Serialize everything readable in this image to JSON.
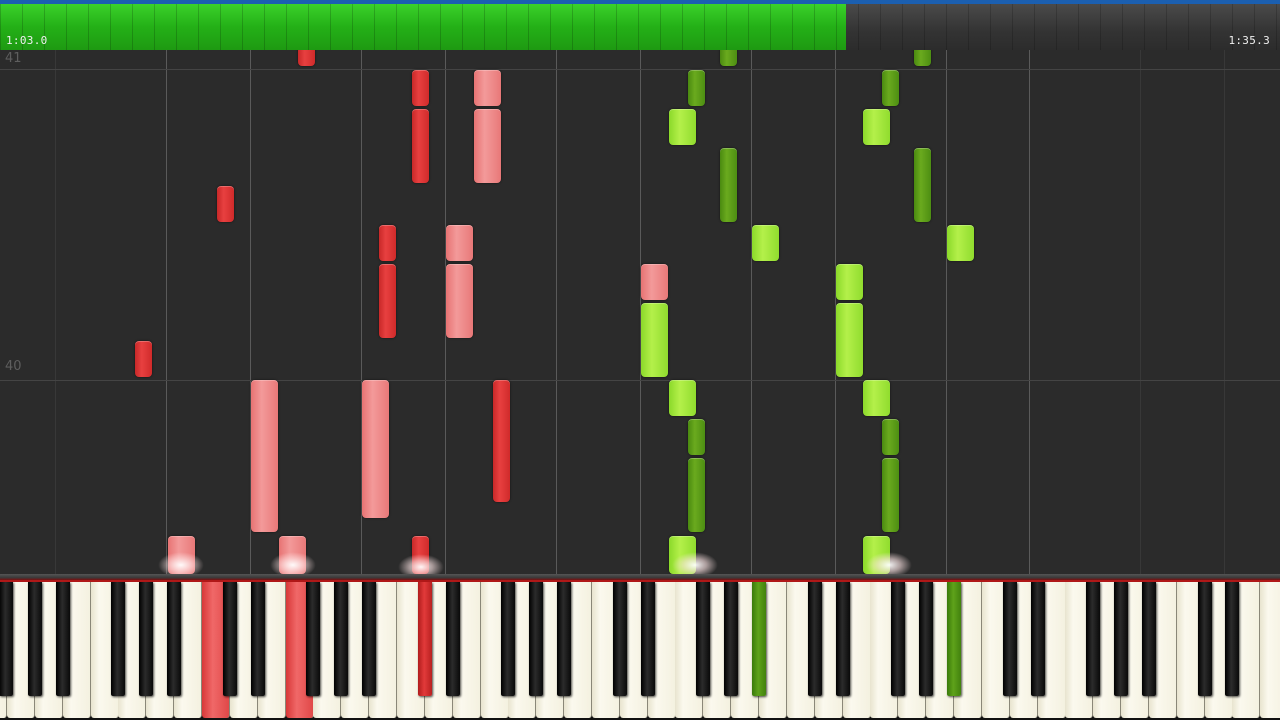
{
  "progress": {
    "current_time": "1:03.0",
    "total_time": "1:35.3",
    "fraction": 0.661,
    "fill_color": "#24b017"
  },
  "measures": [
    {
      "label": "41"
    },
    {
      "label": "40"
    }
  ],
  "colors": {
    "left_hand_dark": "#e84040",
    "left_hand_light": "#f39a9a",
    "right_hand_dark": "#6aaa1e",
    "right_hand_light": "#b4f04a"
  },
  "keyboard": {
    "active_keys_red": [
      "white-7",
      "white-10",
      "black-14"
    ],
    "active_keys_green": [
      "black-26",
      "black-33"
    ]
  }
}
